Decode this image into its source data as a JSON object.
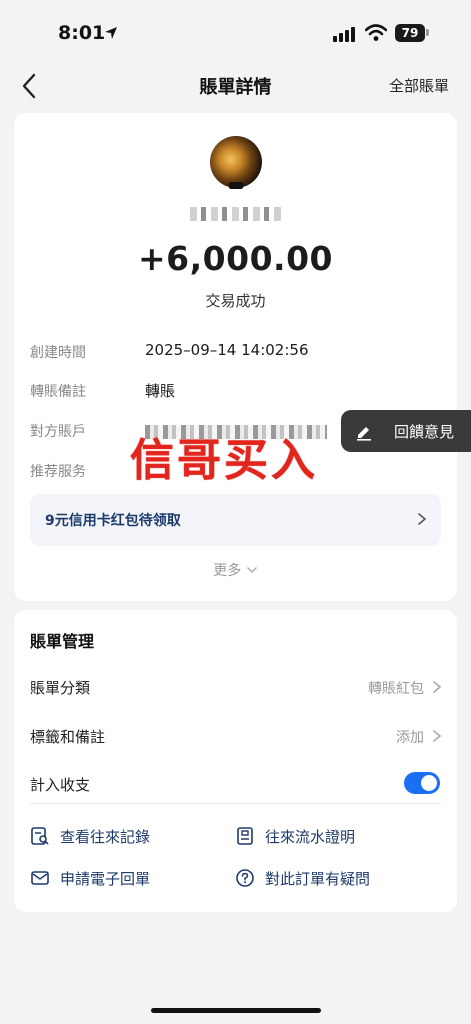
{
  "status_bar": {
    "time": "8:01",
    "battery": "79"
  },
  "nav": {
    "title": "賬單詳情",
    "right_link": "全部賬單"
  },
  "transaction": {
    "amount": "+6,000.00",
    "status": "交易成功",
    "details": [
      {
        "label": "創建時間",
        "value": "2025–09–14 14:02:56"
      },
      {
        "label": "轉賬備註",
        "value": "轉賬"
      },
      {
        "label": "對方賬戶",
        "value": ""
      },
      {
        "label": "推荐服务",
        "value": ""
      }
    ],
    "promo": "9元信用卡红包待领取",
    "more": "更多"
  },
  "watermark": "信哥买入",
  "feedback": {
    "label": "回饋意見"
  },
  "management": {
    "title": "賬單管理",
    "category": {
      "label": "賬單分類",
      "value": "轉賬紅包"
    },
    "tags": {
      "label": "標籤和備註",
      "value": "添加"
    },
    "include": {
      "label": "計入收支",
      "enabled": true
    },
    "actions": [
      {
        "label": "查看往來記錄",
        "icon": "records-search-icon"
      },
      {
        "label": "往來流水證明",
        "icon": "statement-doc-icon"
      },
      {
        "label": "申請電子回單",
        "icon": "mail-icon"
      },
      {
        "label": "對此訂單有疑問",
        "icon": "question-circle-icon"
      }
    ]
  },
  "colors": {
    "accent": "#1a6ff2",
    "link": "#1e3a6b",
    "watermark": "#e2261e"
  }
}
